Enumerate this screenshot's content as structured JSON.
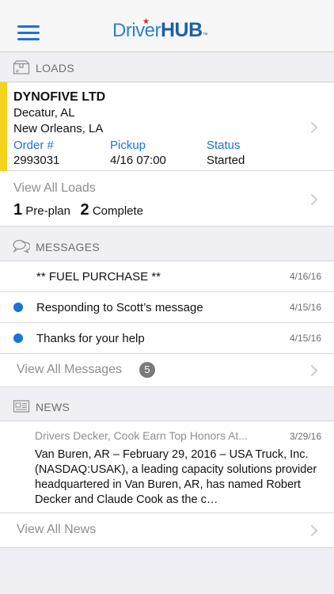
{
  "header": {
    "logo_driver": "Driver",
    "logo_hub": "HUB",
    "logo_tm": "™"
  },
  "loads": {
    "section_title": "LOADS",
    "company": "DYNOFIVE LTD",
    "origin": "Decatur, AL",
    "destination": "New Orleans, LA",
    "order_label": "Order #",
    "order_value": "2993031",
    "pickup_label": "Pickup",
    "pickup_value": "4/16 07:00",
    "status_label": "Status",
    "status_value": "Started",
    "view_all_label": "View All Loads",
    "preplan_count": "1",
    "preplan_label": "Pre-plan",
    "complete_count": "2",
    "complete_label": "Complete",
    "accent_color": "#f5d21b"
  },
  "messages": {
    "section_title": "MESSAGES",
    "items": [
      {
        "text": "** FUEL PURCHASE **",
        "date": "4/16/16",
        "unread": false
      },
      {
        "text": "Responding to Scott’s message",
        "date": "4/15/16",
        "unread": true
      },
      {
        "text": "Thanks for your help",
        "date": "4/15/16",
        "unread": true
      }
    ],
    "view_all_label": "View All Messages",
    "unread_badge": "5"
  },
  "news": {
    "section_title": "NEWS",
    "headline": "Drivers Decker, Cook Earn Top Honors At...",
    "date": "3/29/16",
    "body": "Van Buren, AR – February 29, 2016 – USA Truck, Inc. (NASDAQ:USAK), a leading capacity solutions provider headquartered in Van Buren, AR, has named Robert Decker and Claude Cook as the c…",
    "view_all_label": "View All News"
  },
  "colors": {
    "accent_blue": "#1a73d6",
    "unread_dot": "#1a73d6"
  }
}
